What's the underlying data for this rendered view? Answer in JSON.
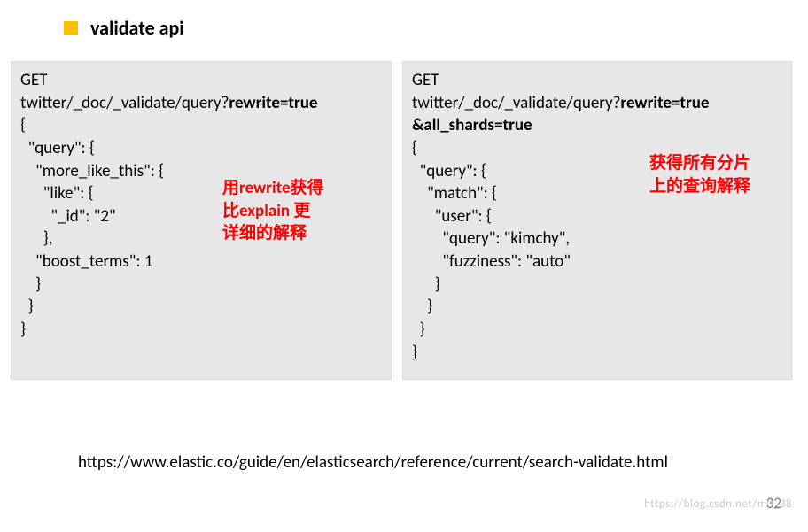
{
  "header": {
    "title": "validate api"
  },
  "left": {
    "method": "GET",
    "path_prefix": "twitter/_doc/_validate/query?",
    "path_param": "rewrite=true",
    "lines": [
      "{",
      "  \"query\": {",
      "    \"more_like_this\": {",
      "      \"like\": {",
      "        \"_id\": \"2\"",
      "      },",
      "    \"boost_terms\": 1",
      "    }",
      "  }",
      "}"
    ],
    "annotation": {
      "l1a": "用",
      "l1b": "rewrite",
      "l1c": "获得",
      "l2a": "比",
      "l2b": "explain ",
      "l2c": "更",
      "l3": "详细的解释"
    }
  },
  "right": {
    "method": "GET",
    "path_prefix": "twitter/_doc/_validate/query?",
    "path_param1": "rewrite=true",
    "path_param2": "&all_shards=true",
    "lines": [
      "{",
      "  \"query\": {",
      "    \"match\": {",
      "      \"user\": {",
      "        \"query\": \"kimchy\",",
      "        \"fuzziness\": \"auto\"",
      "      }",
      "    }",
      "  }",
      "}"
    ],
    "annotation": {
      "l1": "获得所有分片",
      "l2": "上的查询解释"
    }
  },
  "footer": {
    "url": "https://www.elastic.co/guide/en/elasticsearch/reference/current/search-validate.html"
  },
  "page_number": "32",
  "watermark": "https://blog.csdn.net/m0_38"
}
